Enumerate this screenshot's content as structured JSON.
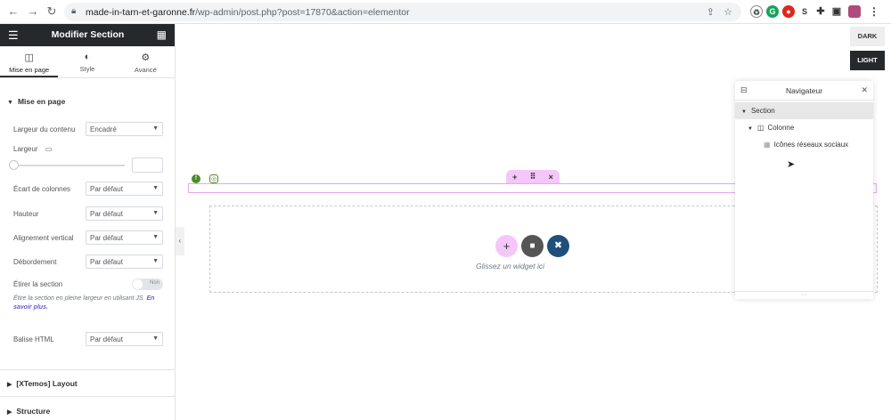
{
  "browser": {
    "url_host": "made-in-tarn-et-garonne.fr",
    "url_path": "/wp-admin/post.php?post=17870&action=elementor"
  },
  "panel": {
    "title": "Modifier Section",
    "tabs": [
      {
        "label": "Mise en page",
        "icon": "layout-icon"
      },
      {
        "label": "Style",
        "icon": "half-circle-icon"
      },
      {
        "label": "Avancé",
        "icon": "gear-icon"
      }
    ],
    "section_layout": "Mise en page",
    "controls": {
      "content_width_label": "Largeur du contenu",
      "content_width_value": "Encadré",
      "width_label": "Largeur",
      "column_gap_label": "Écart de colonnes",
      "column_gap_value": "Par défaut",
      "height_label": "Hauteur",
      "height_value": "Par défaut",
      "valign_label": "Alignement vertical",
      "valign_value": "Par défaut",
      "overflow_label": "Débordement",
      "overflow_value": "Par défaut",
      "stretch_label": "Étirer la section",
      "stretch_toggle": "Non",
      "stretch_help": "Étire la section en pleine largeur en utilisant JS.",
      "stretch_help_link": "En savoir plus.",
      "html_tag_label": "Balise HTML",
      "html_tag_value": "Par défaut"
    },
    "section_xtemos": "[XTemos] Layout",
    "section_structure": "Structure"
  },
  "canvas": {
    "mode_dark": "DARK",
    "mode_light": "LIGHT",
    "dropzone_text": "Glissez un widget ici"
  },
  "navigator": {
    "title": "Navigateur",
    "items": [
      {
        "label": "Section"
      },
      {
        "label": "Colonne"
      },
      {
        "label": "Icônes réseaux sociaux"
      }
    ]
  },
  "colors": {
    "panel_header": "#26292c",
    "section_outline": "#e4a7f0",
    "add_button": "#f5c6f9",
    "folder_button": "#555555",
    "template_button": "#1f4f7a"
  }
}
